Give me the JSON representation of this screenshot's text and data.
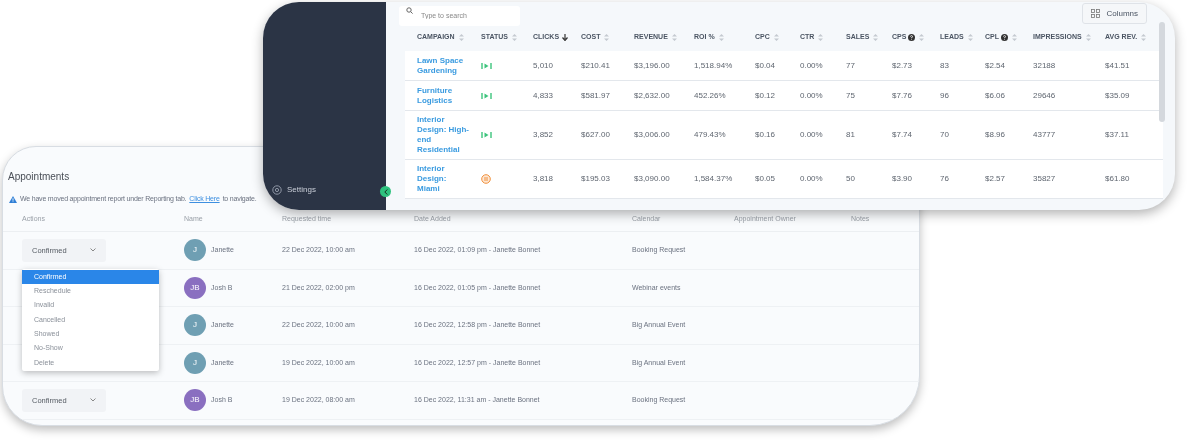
{
  "appointments": {
    "title": "Appointments",
    "banner": {
      "text": "We have moved appointment report under Reporting tab.",
      "link": "Click Here",
      "after": "to navigate."
    },
    "columns": [
      "Actions",
      "Name",
      "Requested time",
      "Date Added",
      "Calendar",
      "Appointment Owner",
      "Notes"
    ],
    "rows": [
      {
        "action": "Confirmed",
        "initials": "J",
        "color": "#6f9fb3",
        "name": "Janette",
        "requested": "22 Dec 2022, 10:00 am",
        "added": "16 Dec 2022, 01:09 pm - Janette Bonnet",
        "calendar": "Booking Request"
      },
      {
        "initials": "JB",
        "color": "#8a6fc0",
        "name": "Josh B",
        "requested": "21 Dec 2022, 02:00 pm",
        "added": "16 Dec 2022, 01:05 pm - Janette Bonnet",
        "calendar": "Webinar events"
      },
      {
        "initials": "J",
        "color": "#6f9fb3",
        "name": "Janette",
        "requested": "22 Dec 2022, 10:00 am",
        "added": "16 Dec 2022, 12:58 pm - Janette Bonnet",
        "calendar": "Big Annual Event"
      },
      {
        "initials": "J",
        "color": "#6f9fb3",
        "name": "Janette",
        "requested": "19 Dec 2022, 10:00 am",
        "added": "16 Dec 2022, 12:57 pm - Janette Bonnet",
        "calendar": "Big Annual Event"
      },
      {
        "action": "Confirmed",
        "initials": "JB",
        "color": "#8a6fc0",
        "name": "Josh B",
        "requested": "19 Dec 2022, 08:00 am",
        "added": "16 Dec 2022, 11:31 am - Janette Bonnet",
        "calendar": "Booking Request"
      }
    ],
    "menu": [
      {
        "label": "Confirmed",
        "selected": true
      },
      {
        "label": "Reschedule",
        "selected": false
      },
      {
        "label": "Invalid",
        "selected": false
      },
      {
        "label": "Cancelled",
        "selected": false
      },
      {
        "label": "Showed",
        "selected": false
      },
      {
        "label": "No-Show",
        "selected": false
      },
      {
        "label": "Delete",
        "selected": false
      }
    ]
  },
  "campaigns": {
    "sidebar": {
      "settings": "Settings"
    },
    "search": {
      "placeholder": "Type to search"
    },
    "columns_button": "Columns",
    "columns": [
      {
        "label": "CAMPAIGN",
        "sorted": false,
        "help": false
      },
      {
        "label": "STATUS",
        "sorted": false,
        "help": false
      },
      {
        "label": "CLICKS",
        "sorted": true,
        "help": false
      },
      {
        "label": "COST",
        "sorted": false,
        "help": false
      },
      {
        "label": "REVENUE",
        "sorted": false,
        "help": false
      },
      {
        "label": "ROI %",
        "sorted": false,
        "help": false
      },
      {
        "label": "CPC",
        "sorted": false,
        "help": false
      },
      {
        "label": "CTR",
        "sorted": false,
        "help": false
      },
      {
        "label": "SALES",
        "sorted": false,
        "help": false
      },
      {
        "label": "CPS",
        "sorted": false,
        "help": true
      },
      {
        "label": "LEADS",
        "sorted": false,
        "help": false
      },
      {
        "label": "CPL",
        "sorted": false,
        "help": true
      },
      {
        "label": "IMPRESSIONS",
        "sorted": false,
        "help": false
      },
      {
        "label": "AVG REV.",
        "sorted": false,
        "help": false
      }
    ],
    "rows": [
      {
        "campaign": "Lawn Space Gardening",
        "kind": "active",
        "values": [
          "5,010",
          "$210.41",
          "$3,196.00",
          "1,518.94%",
          "$0.04",
          "0.00%",
          "77",
          "$2.73",
          "83",
          "$2.54",
          "32188",
          "$41.51"
        ]
      },
      {
        "campaign": "Furniture Logistics",
        "kind": "active",
        "values": [
          "4,833",
          "$581.97",
          "$2,632.00",
          "452.26%",
          "$0.12",
          "0.00%",
          "75",
          "$7.76",
          "96",
          "$6.06",
          "29646",
          "$35.09"
        ]
      },
      {
        "campaign": "Interior Design: High-end Residential",
        "kind": "active",
        "values": [
          "3,852",
          "$627.00",
          "$3,006.00",
          "479.43%",
          "$0.16",
          "0.00%",
          "81",
          "$7.74",
          "70",
          "$8.96",
          "43777",
          "$37.11"
        ]
      },
      {
        "campaign": "Interior Design: Miami",
        "kind": "paused",
        "values": [
          "3,818",
          "$195.03",
          "$3,090.00",
          "1,584.37%",
          "$0.05",
          "0.00%",
          "50",
          "$3.90",
          "76",
          "$2.57",
          "35827",
          "$61.80"
        ]
      }
    ]
  }
}
